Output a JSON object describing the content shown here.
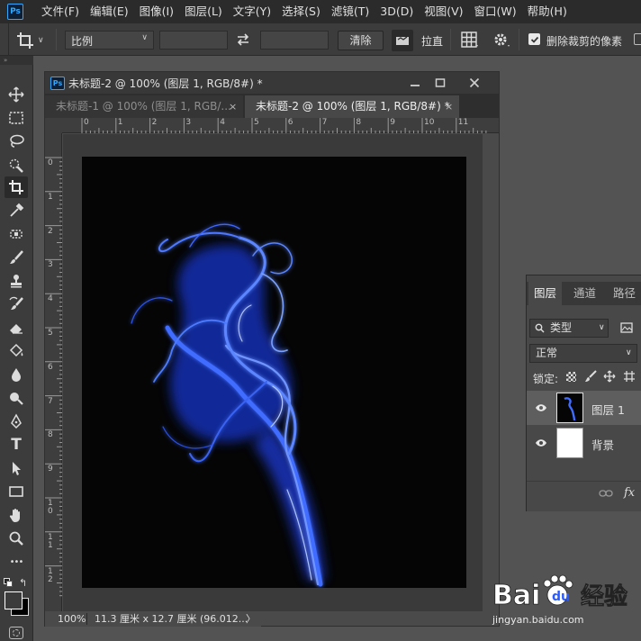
{
  "app": {
    "logo_text": "Ps"
  },
  "menu": [
    "文件(F)",
    "编辑(E)",
    "图像(I)",
    "图层(L)",
    "文字(Y)",
    "选择(S)",
    "滤镜(T)",
    "3D(D)",
    "视图(V)",
    "窗口(W)",
    "帮助(H)"
  ],
  "options": {
    "ratio_select": "比例",
    "clear_button": "清除",
    "straighten_label": "拉直",
    "delete_cropped_label": "删除裁剪的像素",
    "delete_cropped_checked": true
  },
  "toolbar": {
    "tools": [
      "move-tool",
      "marquee-tool",
      "lasso-tool",
      "quick-select-tool",
      "crop-tool",
      "eyedropper-tool",
      "healing-tool",
      "brush-tool",
      "stamp-tool",
      "history-brush-tool",
      "eraser-tool",
      "paint-bucket-tool",
      "blur-tool",
      "dodge-tool",
      "pen-tool",
      "type-tool",
      "path-select-tool",
      "rectangle-tool",
      "hand-tool",
      "zoom-tool",
      "more-tools"
    ],
    "active_tool": "crop-tool",
    "type_tool_glyph": "T",
    "more_glyph": "•••"
  },
  "document": {
    "ps_icon": "Ps",
    "window_title": "未标题-2 @ 100% (图层 1, RGB/8#) *",
    "tabs": [
      {
        "label": "未标题-1 @ 100% (图层 1, RGB/...",
        "close": "×",
        "active": false
      },
      {
        "label": "未标题-2 @ 100% (图层 1, RGB/8#) *",
        "close": "×",
        "active": true
      }
    ],
    "ruler_top_labels": [
      "0",
      "1",
      "2",
      "3",
      "4",
      "5",
      "6",
      "7",
      "8",
      "9",
      "10",
      "11"
    ],
    "ruler_left_labels": [
      "0",
      "1",
      "2",
      "3",
      "4",
      "5",
      "6",
      "7",
      "8",
      "9",
      "1 0",
      "1 1",
      "1 2"
    ],
    "status": {
      "zoom": "100%",
      "size": "11.3 厘米 x 12.7 厘米 (96.012...",
      "arrow": "〉"
    }
  },
  "layers_panel": {
    "tabs": [
      "图层",
      "通道",
      "路径"
    ],
    "filter_label": "类型",
    "blend_mode": "正常",
    "lock_label": "锁定:",
    "layers": [
      {
        "name": "图层 1",
        "visible": true,
        "selected": true
      },
      {
        "name": "背景",
        "visible": true,
        "selected": false
      }
    ],
    "fx_label": "fx"
  },
  "watermark": {
    "brand": "Baidu",
    "cn": "经验",
    "url": "jingyan.baidu.com"
  },
  "colors": {
    "menubar": "#2b2b2b",
    "panel": "#3c3c3c",
    "workspace": "#535353",
    "ps_blue": "#31a8ff",
    "smoke_blue": "#2a5bff"
  }
}
